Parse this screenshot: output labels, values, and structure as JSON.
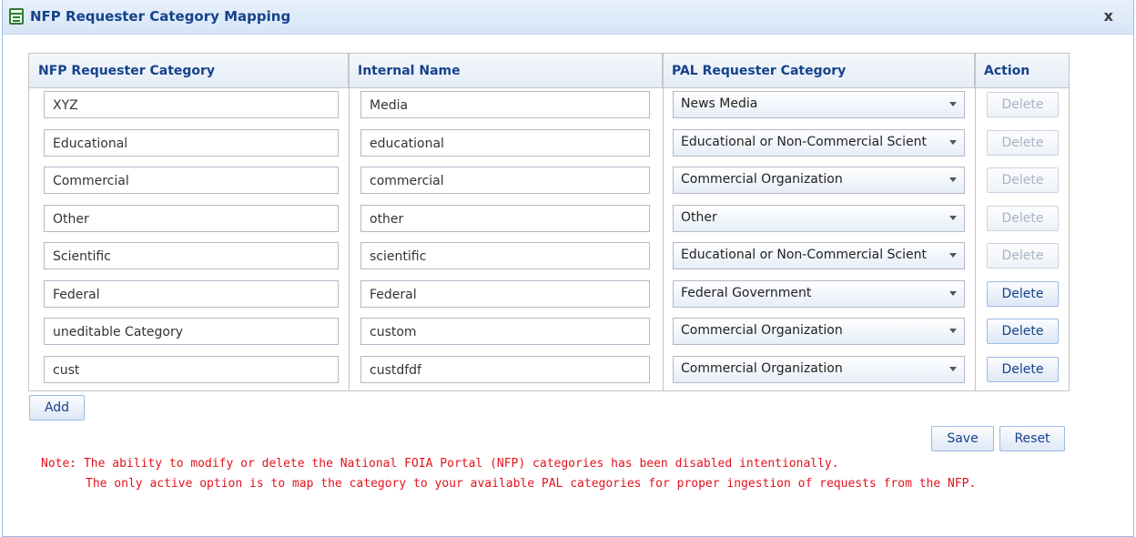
{
  "window": {
    "title": "NFP Requester Category Mapping",
    "close_label": "x"
  },
  "grid": {
    "columns": [
      "NFP Requester Category",
      "Internal Name",
      "PAL Requester Category",
      "Action"
    ],
    "rows": [
      {
        "category": "XYZ",
        "internal": "Media",
        "pal": "News Media",
        "action": "Delete",
        "action_enabled": false
      },
      {
        "category": "Educational",
        "internal": "educational",
        "pal": "Educational or Non-Commercial Scient",
        "action": "Delete",
        "action_enabled": false
      },
      {
        "category": "Commercial",
        "internal": "commercial",
        "pal": "Commercial Organization",
        "action": "Delete",
        "action_enabled": false
      },
      {
        "category": "Other",
        "internal": "other",
        "pal": "Other",
        "action": "Delete",
        "action_enabled": false
      },
      {
        "category": "Scientific",
        "internal": "scientific",
        "pal": "Educational or Non-Commercial Scient",
        "action": "Delete",
        "action_enabled": false
      },
      {
        "category": "Federal",
        "internal": "Federal",
        "pal": "Federal Government",
        "action": "Delete",
        "action_enabled": true
      },
      {
        "category": "uneditable Category",
        "internal": "custom",
        "pal": "Commercial Organization",
        "action": "Delete",
        "action_enabled": true
      },
      {
        "category": "cust",
        "internal": "custdfdf",
        "pal": "Commercial Organization",
        "action": "Delete",
        "action_enabled": true
      }
    ]
  },
  "buttons": {
    "add": "Add",
    "save": "Save",
    "reset": "Reset"
  },
  "note": {
    "line1": "Note: The ability to modify or delete the National FOIA Portal (NFP) categories has been disabled intentionally.",
    "line2": "The only active option is to map the category to your available PAL categories for proper ingestion of requests from the NFP."
  },
  "colors": {
    "title": "#15428b",
    "note": "#e3131b",
    "border": "#99bbe8"
  }
}
